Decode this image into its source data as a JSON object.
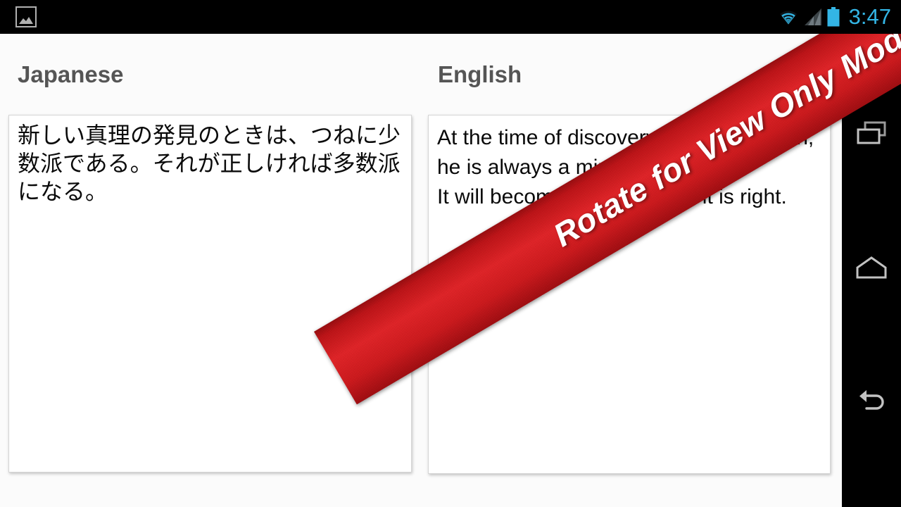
{
  "status_bar": {
    "notification_icon": "image-gallery-icon",
    "wifi_icon": "wifi-icon",
    "signal_icon": "cellular-signal-icon",
    "battery_icon": "battery-icon",
    "time": "3:47",
    "accent_color": "#33b5e5",
    "background_color": "#000000"
  },
  "panes": {
    "japanese": {
      "title": "Japanese",
      "text": "新しい真理の発見のときは、つねに少数派である。それが正しければ多数派になる。"
    },
    "english": {
      "title": "English",
      "text": "At the time of discovery of the new truth, he is always a minority group.\nIt will become the majority if it is right."
    }
  },
  "ribbon": {
    "label": "Rotate for View Only Mode",
    "color": "#d41b1f",
    "text_color": "#ffffff"
  },
  "nav_bar": {
    "buttons": [
      {
        "name": "recents",
        "icon": "recent-apps-icon"
      },
      {
        "name": "home",
        "icon": "home-icon"
      },
      {
        "name": "back",
        "icon": "back-arrow-icon"
      }
    ],
    "background_color": "#000000"
  },
  "theme": {
    "app_background": "#fbfbfb",
    "card_background": "#ffffff",
    "card_border": "#d5d5d5",
    "title_color": "#555555",
    "body_text_color": "#0a0a0a"
  }
}
